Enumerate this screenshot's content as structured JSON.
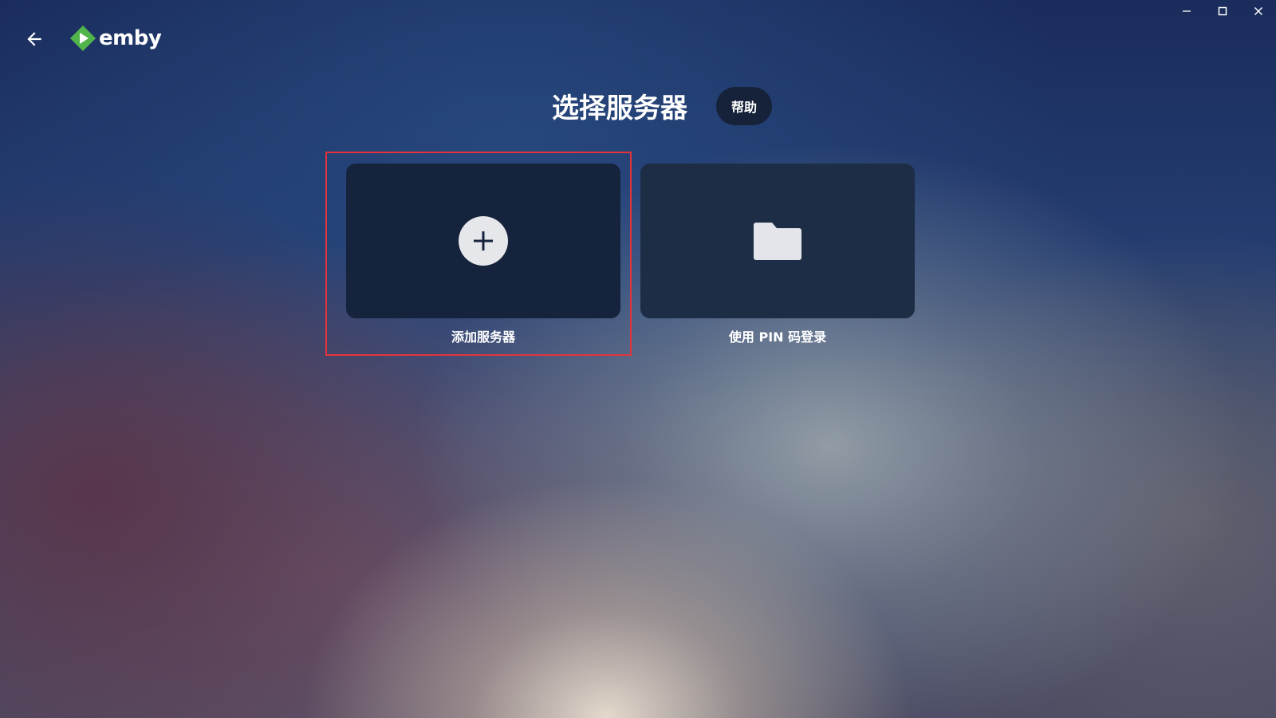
{
  "window": {
    "controls": [
      "minimize",
      "maximize",
      "close"
    ]
  },
  "header": {
    "logo_text": "emby",
    "title": "选择服务器",
    "help_label": "帮助"
  },
  "cards": [
    {
      "label": "添加服务器",
      "icon": "plus-circle-icon",
      "selected": true
    },
    {
      "label": "使用 PIN 码登录",
      "icon": "folder-icon",
      "selected": false
    }
  ],
  "colors": {
    "accent_green": "#52b54b",
    "highlight_border": "#e3343c",
    "card_bg": "#16233d"
  }
}
